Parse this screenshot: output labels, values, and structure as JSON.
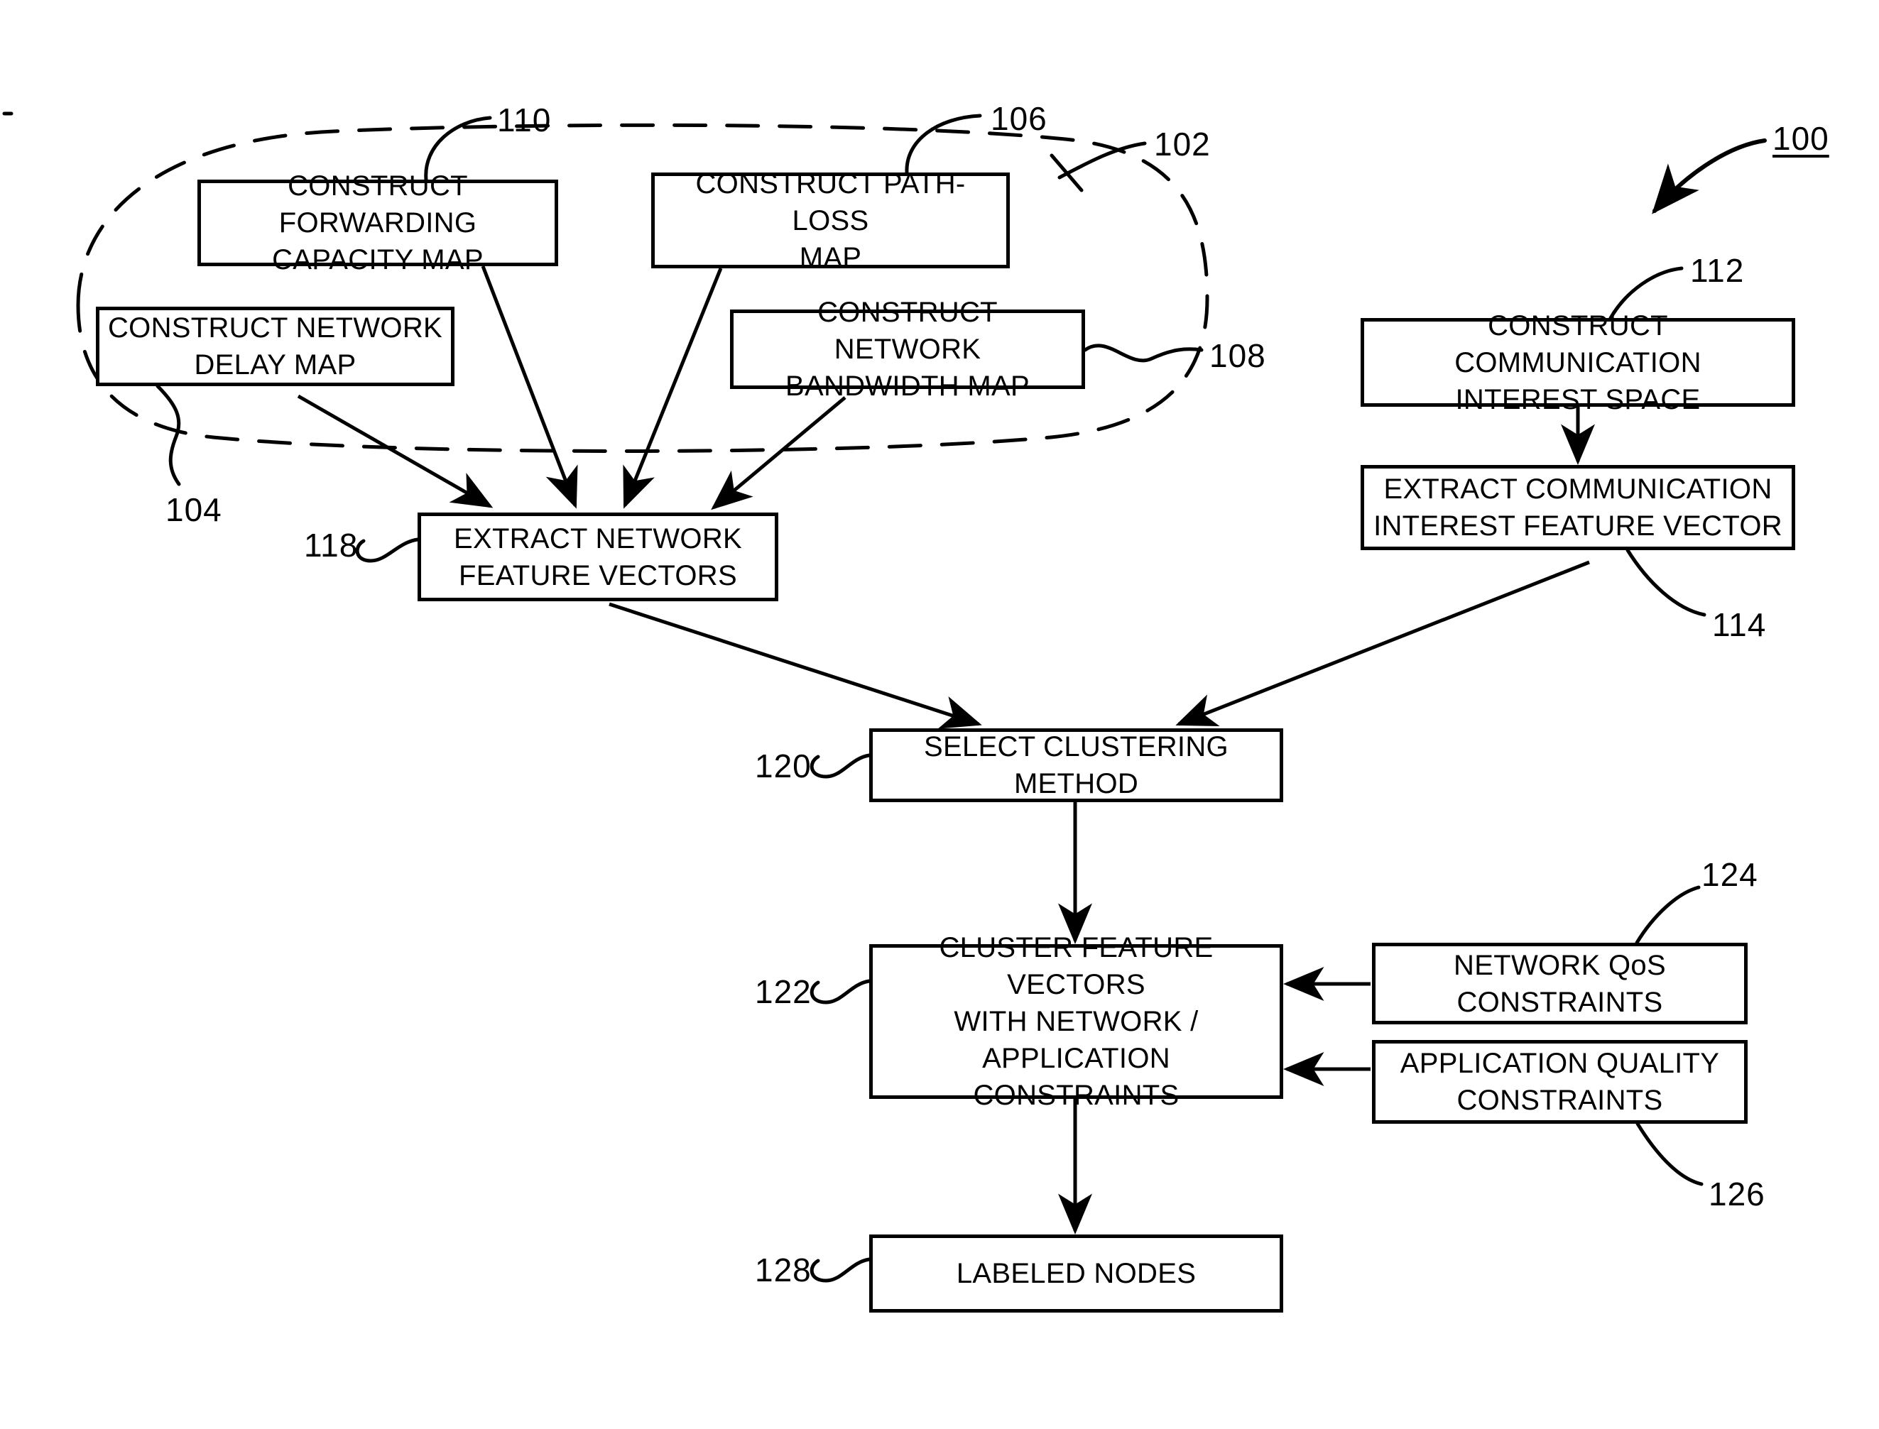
{
  "figure": {
    "type": "patent-flowchart",
    "background_color": "#ffffff",
    "line_color": "#000000"
  },
  "nodes": {
    "forwarding": {
      "label": "CONSTRUCT FORWARDING\nCAPACITY MAP",
      "ref": "110"
    },
    "pathloss": {
      "label": "CONSTRUCT PATH-LOSS\nMAP",
      "ref": "106"
    },
    "delay": {
      "label": "CONSTRUCT NETWORK\nDELAY MAP",
      "ref": "104"
    },
    "bandwidth": {
      "label": "CONSTRUCT NETWORK\nBANDWIDTH MAP",
      "ref": "108"
    },
    "commspace": {
      "label": "CONSTRUCT COMMUNICATION\nINTEREST SPACE",
      "ref": "112"
    },
    "commvector": {
      "label": "EXTRACT COMMUNICATION\nINTEREST FEATURE VECTOR",
      "ref": "114"
    },
    "extractnet": {
      "label": "EXTRACT NETWORK\nFEATURE VECTORS",
      "ref": "118"
    },
    "selectclust": {
      "label": "SELECT CLUSTERING METHOD",
      "ref": "120"
    },
    "clusterfv": {
      "label": "CLUSTER FEATURE VECTORS\nWITH NETWORK / APPLICATION\nCONSTRAINTS",
      "ref": "122"
    },
    "qos": {
      "label": "NETWORK QoS\nCONSTRAINTS",
      "ref": "124"
    },
    "appquality": {
      "label": "APPLICATION QUALITY\nCONSTRAINTS",
      "ref": "126"
    },
    "labelednodes": {
      "label": "LABELED NODES",
      "ref": "128"
    }
  },
  "reference_numerals": {
    "n100": "100",
    "n102": "102",
    "n104": "104",
    "n106": "106",
    "n108": "108",
    "n110": "110",
    "n112": "112",
    "n114": "114",
    "n118": "118",
    "n120": "120",
    "n122": "122",
    "n124": "124",
    "n126": "126",
    "n128": "128"
  },
  "grouping": {
    "dashed_enclosure_ref": "102",
    "dashed_enclosure_members": [
      "forwarding",
      "pathloss",
      "delay",
      "bandwidth"
    ]
  }
}
